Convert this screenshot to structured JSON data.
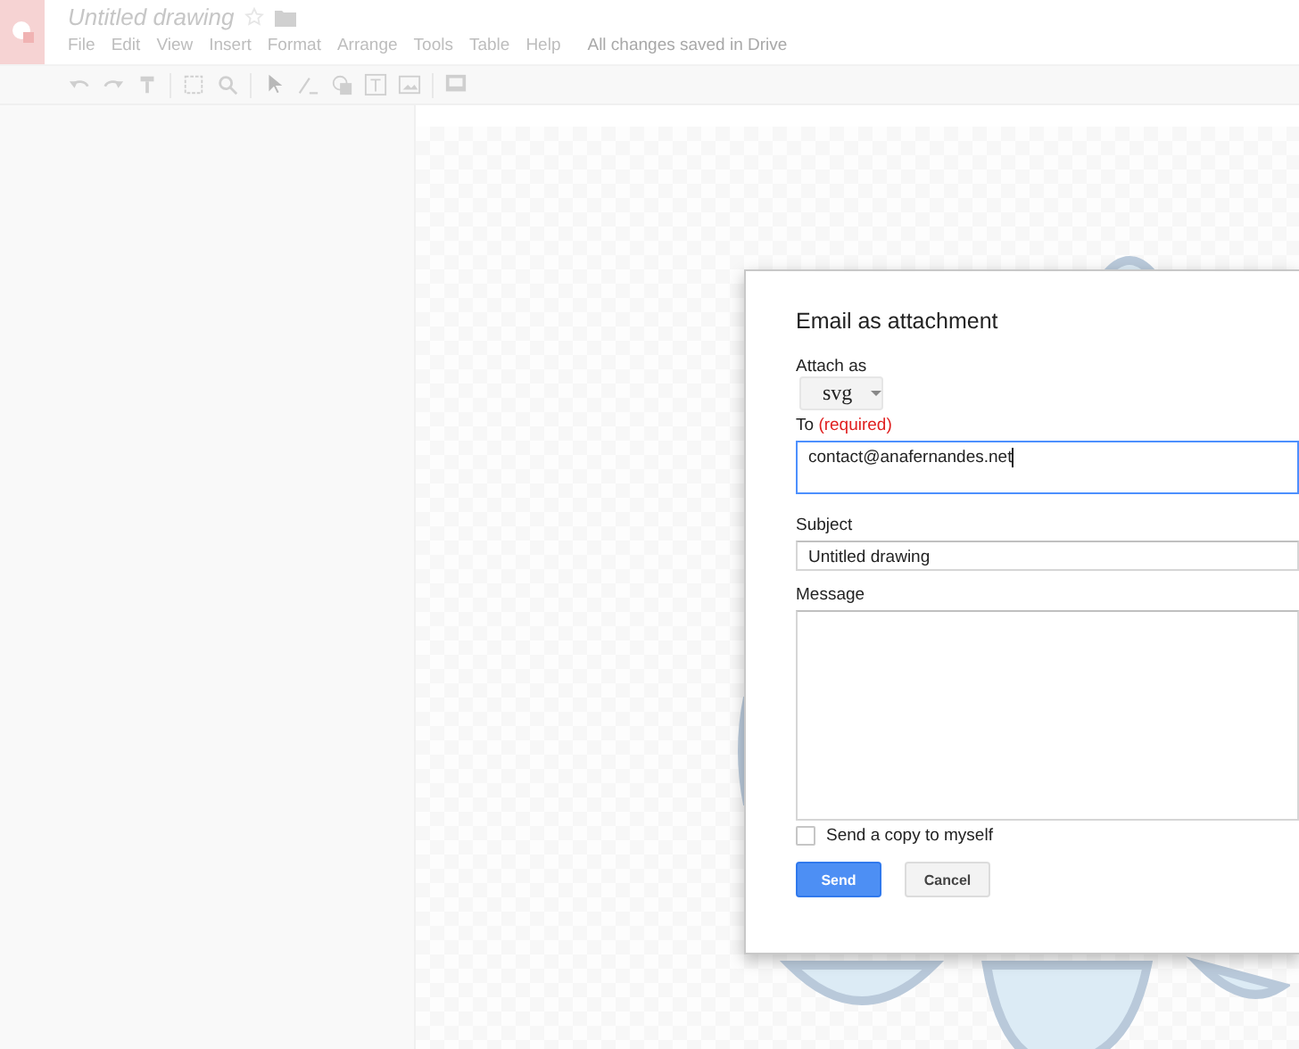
{
  "app": {
    "title": "Untitled drawing",
    "menu": [
      "File",
      "Edit",
      "View",
      "Insert",
      "Format",
      "Arrange",
      "Tools",
      "Table",
      "Help"
    ],
    "save_status": "All changes saved in Drive"
  },
  "dialog": {
    "title": "Email as attachment",
    "attach_label": "Attach as",
    "attach_value": "svg",
    "to_label": "To",
    "to_required": "(required)",
    "to_value": "contact@anafernandes.net",
    "subject_label": "Subject",
    "subject_value": "Untitled drawing",
    "message_label": "Message",
    "copy_label": "Send a copy to myself",
    "copy_checked": false,
    "buttons": [
      {
        "label": "Send",
        "kind": "primary"
      },
      {
        "label": "Cancel",
        "kind": "secondary"
      }
    ]
  }
}
